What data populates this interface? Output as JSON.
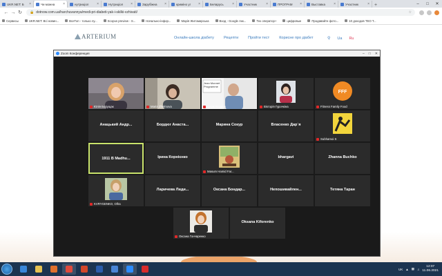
{
  "browser": {
    "tabs": [
      {
        "label": "UKR.NET: Б",
        "active": false
      },
      {
        "label": "Чи можна",
        "active": true
      },
      {
        "label": "нутриціол",
        "active": false
      },
      {
        "label": "Нутриціол",
        "active": false
      },
      {
        "label": "Зарубіжна",
        "active": false
      },
      {
        "label": "криміно уг",
        "active": false
      },
      {
        "label": "Беларусь",
        "active": false
      },
      {
        "label": "Участник",
        "active": false
      },
      {
        "label": "ПРОГРАМ",
        "active": false
      },
      {
        "label": "Выставка",
        "active": false
      },
      {
        "label": "Участник",
        "active": false
      }
    ],
    "new_tab": "+",
    "url": "dotnow.com.ua/harchuvannya/medi-pri-diabeti-yak-i-skilki-vzhivati/",
    "bookmarks": [
      "Сервисы",
      "UKR.NET: Всі новин...",
      "ВсеТоп - только лу...",
      "Scopus preview - S...",
      "Начально-інфор...",
      "Марія Житомирська",
      "Вход - Google Акк...",
      "Тех оператор+",
      "цифровые",
      "Продавайте фото...",
      "10 доходов ТЕО Т..."
    ]
  },
  "website": {
    "logo": "ARTERIUM",
    "nav": [
      "Онлайн-школа діабету",
      "Рецепти",
      "Пройти тест",
      "Корисне про діабет"
    ],
    "lang_ua": "Ua",
    "lang_ru": "Ru"
  },
  "zoom": {
    "title": "Zoom Конференция",
    "participants": [
      {
        "name": "Юлія Борущак",
        "video": true,
        "muted": true,
        "style": "blonde"
      },
      {
        "name": "Maria Zhelmova",
        "video": true,
        "muted": true,
        "style": "dark"
      },
      {
        "name": "Серж Кіпуров",
        "video": true,
        "muted": true,
        "style": "man"
      },
      {
        "name": "Вікторія Гурочкіна",
        "video": true,
        "muted": true,
        "style": "photo"
      },
      {
        "name": "Fitness Family Food",
        "video": true,
        "muted": true,
        "style": "fff",
        "logo_text": "FFF"
      },
      {
        "name": "Анацький Андр...",
        "video": false,
        "muted": false
      },
      {
        "name": "Бордюг Анаста...",
        "video": false,
        "muted": false
      },
      {
        "name": "Марина Сокур",
        "video": false,
        "muted": false
      },
      {
        "name": "Власенко Дар`я",
        "video": false,
        "muted": false
      },
      {
        "name": "Subhamoi S",
        "video": true,
        "muted": true,
        "style": "yoga"
      },
      {
        "name": "1911 В Madhu...",
        "video": false,
        "muted": false,
        "active": true
      },
      {
        "name": "Ірина Корнієнко",
        "video": false,
        "muted": false
      },
      {
        "name": "Masum Hamid Far...",
        "video": true,
        "muted": true,
        "style": "art"
      },
      {
        "name": "bhargavi",
        "video": false,
        "muted": false
      },
      {
        "name": "Zhanna Buchko",
        "video": false,
        "muted": false
      },
      {
        "name": "KVRYGENKO, Olha",
        "video": true,
        "muted": true,
        "style": "woman-photo"
      },
      {
        "name": "Ларичева Лиди...",
        "video": false,
        "muted": false
      },
      {
        "name": "Оксана Бондар...",
        "video": false,
        "muted": false
      },
      {
        "name": "Непошивайлен...",
        "video": false,
        "muted": false
      },
      {
        "name": "Тетяна Таран",
        "video": false,
        "muted": false
      },
      {
        "name": "Оксана Гончаренко",
        "video": true,
        "muted": true,
        "style": "woman-photo2"
      },
      {
        "name": "Oksana Kiforenko",
        "video": false,
        "muted": false
      }
    ]
  },
  "taskbar": {
    "apps": [
      {
        "name": "ie",
        "color": "#3a86d8",
        "open": false
      },
      {
        "name": "explorer",
        "color": "#e7c252",
        "open": false
      },
      {
        "name": "media",
        "color": "#e0702c",
        "open": false
      },
      {
        "name": "chrome",
        "color": "#e04a3c",
        "open": true
      },
      {
        "name": "powerpoint",
        "color": "#d2472a",
        "open": false
      },
      {
        "name": "word",
        "color": "#2b5cab",
        "open": false
      },
      {
        "name": "app7",
        "color": "#4a84d4",
        "open": false
      },
      {
        "name": "zoom",
        "color": "#2d8cff",
        "open": true
      },
      {
        "name": "opera",
        "color": "#d92b2b",
        "open": false
      }
    ],
    "lang": "UK",
    "time": "12:07",
    "date": "11.06.2021"
  },
  "colors": {
    "zoom_bg": "#1a1a1a",
    "tile_bg": "#2b2b2b",
    "active_speaker": "#c9e36b",
    "link_blue": "#3a7bbd"
  }
}
